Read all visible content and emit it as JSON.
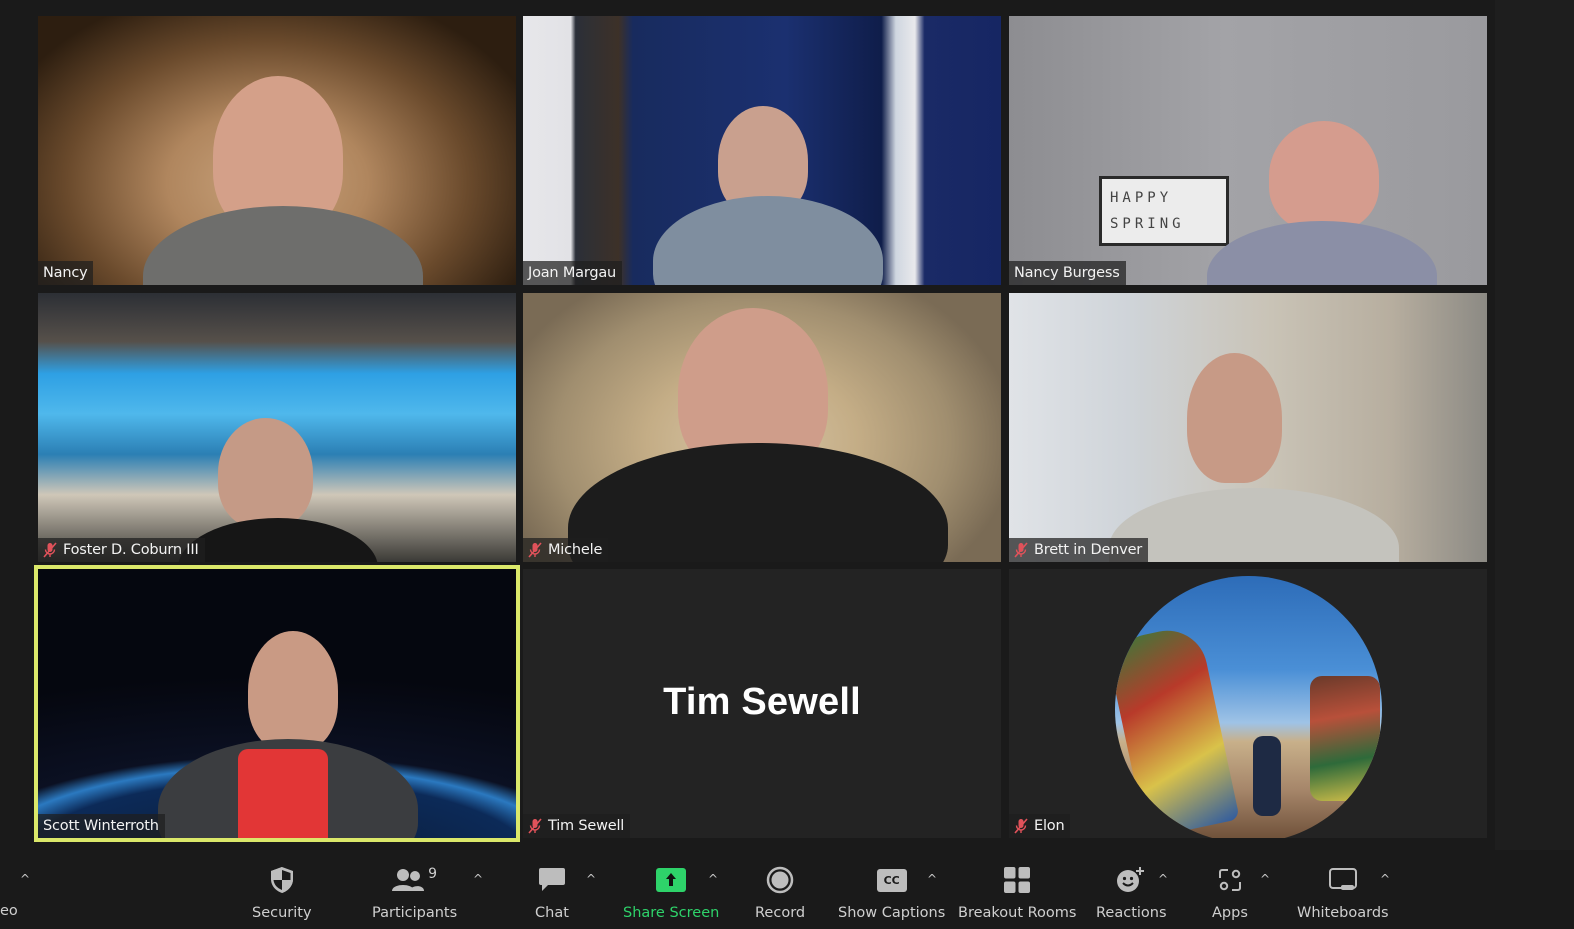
{
  "app": "Zoom Meeting",
  "gallery": {
    "tiles": [
      {
        "name": "Nancy",
        "muted": false,
        "video": true,
        "active_speaker": false
      },
      {
        "name": "Joan Margau",
        "muted": false,
        "video": true,
        "active_speaker": false
      },
      {
        "name": "Nancy Burgess",
        "muted": false,
        "video": true,
        "active_speaker": false,
        "background_sign": [
          "HAPPY",
          "SPRING"
        ]
      },
      {
        "name": "Foster D. Coburn III",
        "muted": true,
        "video": true,
        "active_speaker": false
      },
      {
        "name": "Michele",
        "muted": true,
        "video": true,
        "active_speaker": false
      },
      {
        "name": "Brett in Denver",
        "muted": true,
        "video": true,
        "active_speaker": false
      },
      {
        "name": "Scott Winterroth",
        "muted": false,
        "video": true,
        "active_speaker": true
      },
      {
        "name": "Tim Sewell",
        "muted": true,
        "video": false,
        "active_speaker": false,
        "display_name": "Tim Sewell"
      },
      {
        "name": "Elon",
        "muted": true,
        "video": false,
        "active_speaker": false,
        "avatar": "profile-photo"
      }
    ]
  },
  "toolbar": {
    "partial_label": "eo",
    "items": [
      {
        "id": "security",
        "label": "Security",
        "icon": "shield-icon"
      },
      {
        "id": "participants",
        "label": "Participants",
        "icon": "participants-icon",
        "count": "9"
      },
      {
        "id": "chat",
        "label": "Chat",
        "icon": "chat-bubble-icon"
      },
      {
        "id": "share-screen",
        "label": "Share Screen",
        "icon": "share-arrow-icon"
      },
      {
        "id": "record",
        "label": "Record",
        "icon": "record-icon"
      },
      {
        "id": "show-captions",
        "label": "Show Captions",
        "icon": "cc-icon",
        "icon_text": "CC"
      },
      {
        "id": "breakout-rooms",
        "label": "Breakout Rooms",
        "icon": "grid-icon"
      },
      {
        "id": "reactions",
        "label": "Reactions",
        "icon": "emoji-plus-icon"
      },
      {
        "id": "apps",
        "label": "Apps",
        "icon": "apps-icon"
      },
      {
        "id": "whiteboards",
        "label": "Whiteboards",
        "icon": "whiteboard-icon"
      }
    ],
    "caret_glyph": "^"
  },
  "colors": {
    "background": "#1a1a1a",
    "active_speaker_border": "#dbe86a",
    "share_green": "#2ed36a",
    "muted_red": "#e0525a",
    "toolbar_text": "#cfcfcf"
  }
}
